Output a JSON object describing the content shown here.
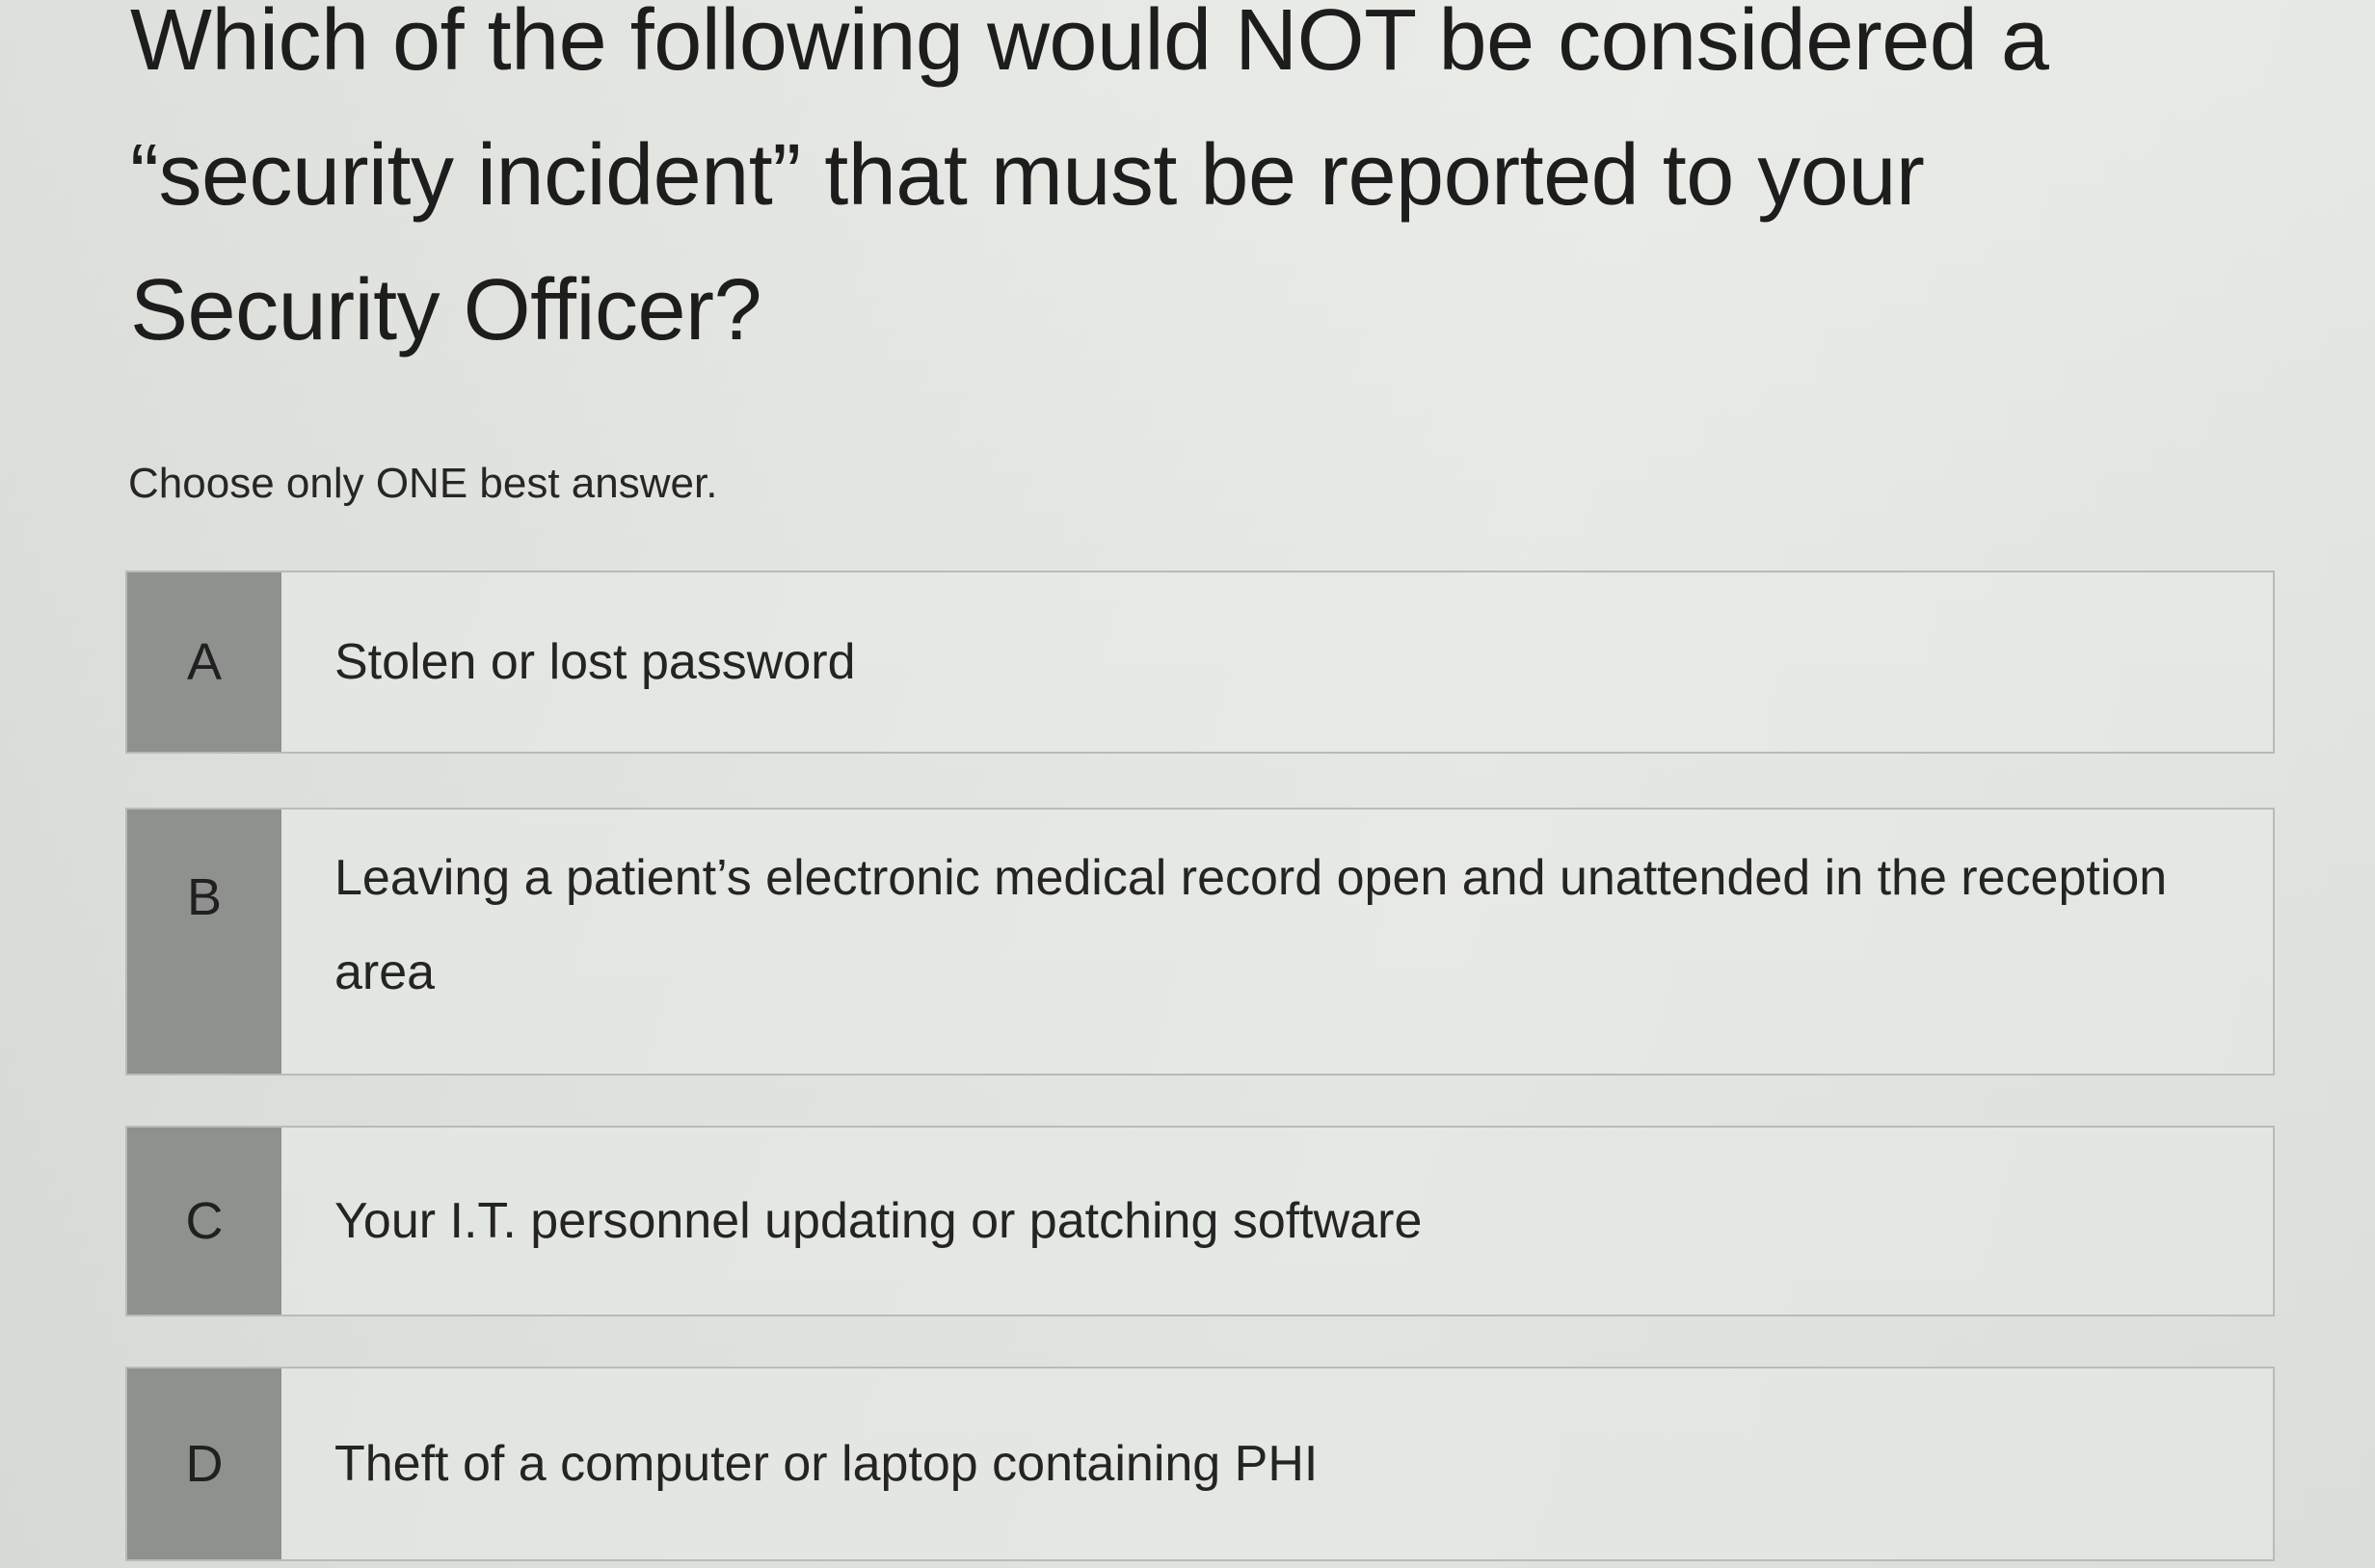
{
  "question": {
    "text": "Which of the following would NOT be considered a\n“security incident” that must be reported to your\nSecurity Officer?"
  },
  "instruction": "Choose only ONE best answer.",
  "options": [
    {
      "letter": "A",
      "text": "Stolen or lost password"
    },
    {
      "letter": "B",
      "text": "Leaving a patient’s electronic medical record open and unattended in the reception area"
    },
    {
      "letter": "C",
      "text": "Your I.T. personnel updating or patching software"
    },
    {
      "letter": "D",
      "text": "Theft of a computer or laptop containing PHI"
    }
  ]
}
